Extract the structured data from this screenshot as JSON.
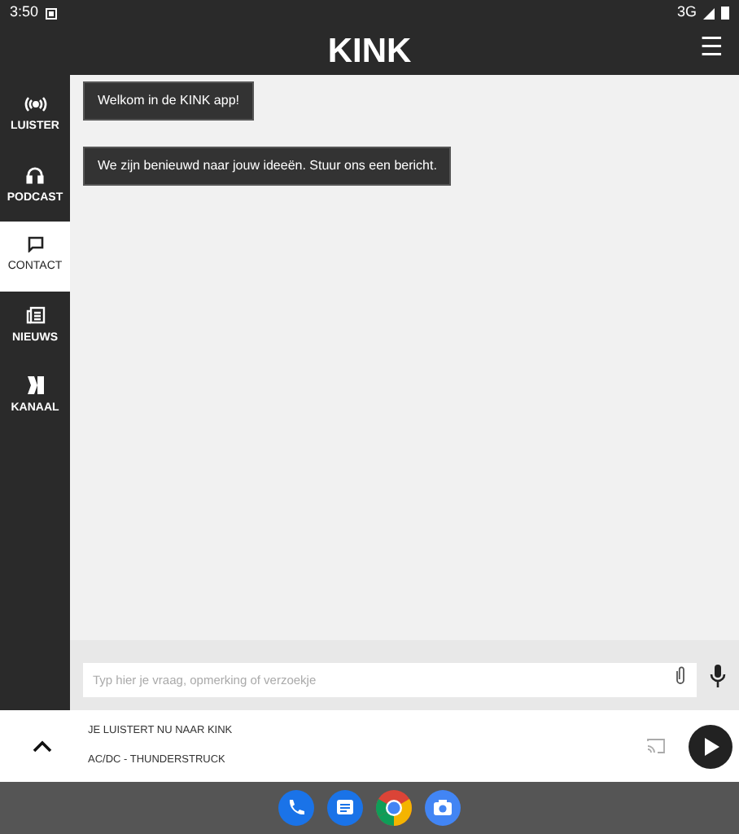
{
  "status_bar": {
    "time": "3:50",
    "network": "3G"
  },
  "app_bar": {
    "logo": "KINK",
    "menu": "☰"
  },
  "sidebar": {
    "items": [
      {
        "label": "LUISTER",
        "selected": false
      },
      {
        "label": "PODCAST",
        "selected": false
      },
      {
        "label": "CONTACT",
        "selected": true
      },
      {
        "label": "NIEUWS",
        "selected": false
      },
      {
        "label": "KANAAL",
        "selected": false
      }
    ]
  },
  "messages": [
    {
      "text": "Welkom in de KINK app!"
    },
    {
      "text": "We zijn benieuwd naar jouw ideeën. Stuur ons een bericht."
    }
  ],
  "composer": {
    "placeholder": "Typ hier je vraag, opmerking of verzoekje"
  },
  "player": {
    "title": "JE LUISTERT NU NAAR KINK",
    "track": "AC/DC - THUNDERSTRUCK"
  }
}
